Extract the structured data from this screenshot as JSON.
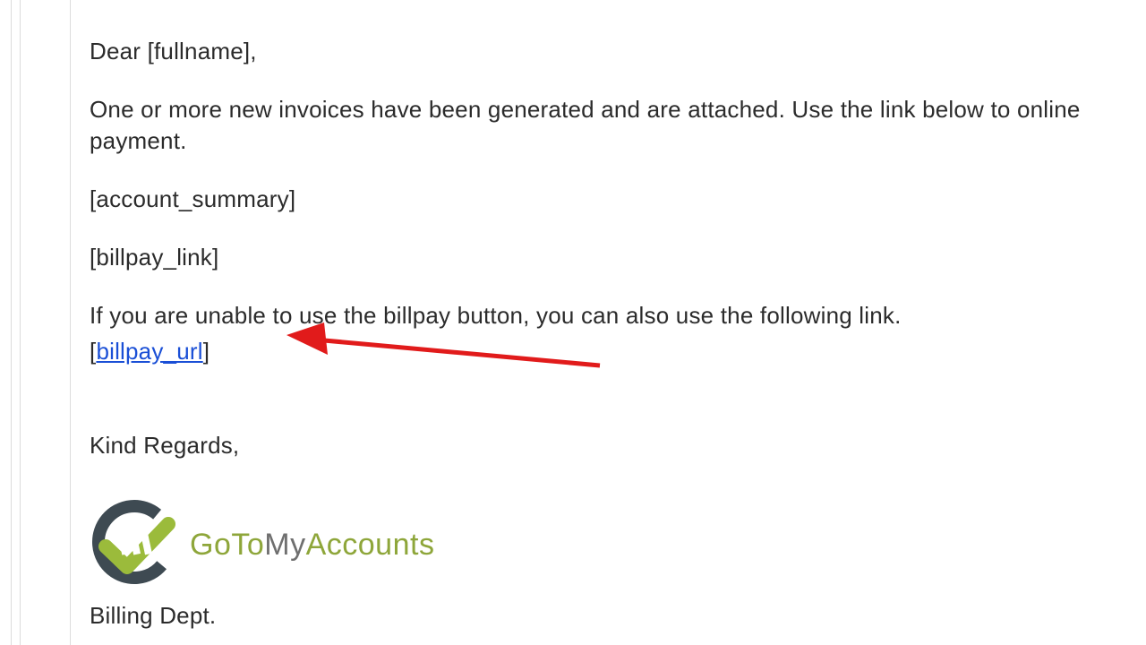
{
  "email": {
    "greeting": "Dear [fullname],",
    "intro": "One or more new invoices have been generated and are attached.  Use the link below to online payment.",
    "account_summary_token": "[account_summary]",
    "billpay_link_token": "[billpay_link]",
    "alt_instruction": "If you are unable to use the billpay button, you can also use the following link.",
    "billpay_url_open": "[",
    "billpay_url_text": "billpay_url",
    "billpay_url_close": "]",
    "signoff": "Kind Regards,",
    "logo_part1": "GoTo",
    "logo_part2": "My",
    "logo_part3": "Accounts",
    "billing_dept": "Billing Dept."
  },
  "annotation": {
    "arrow_color": "#e11b1b"
  }
}
